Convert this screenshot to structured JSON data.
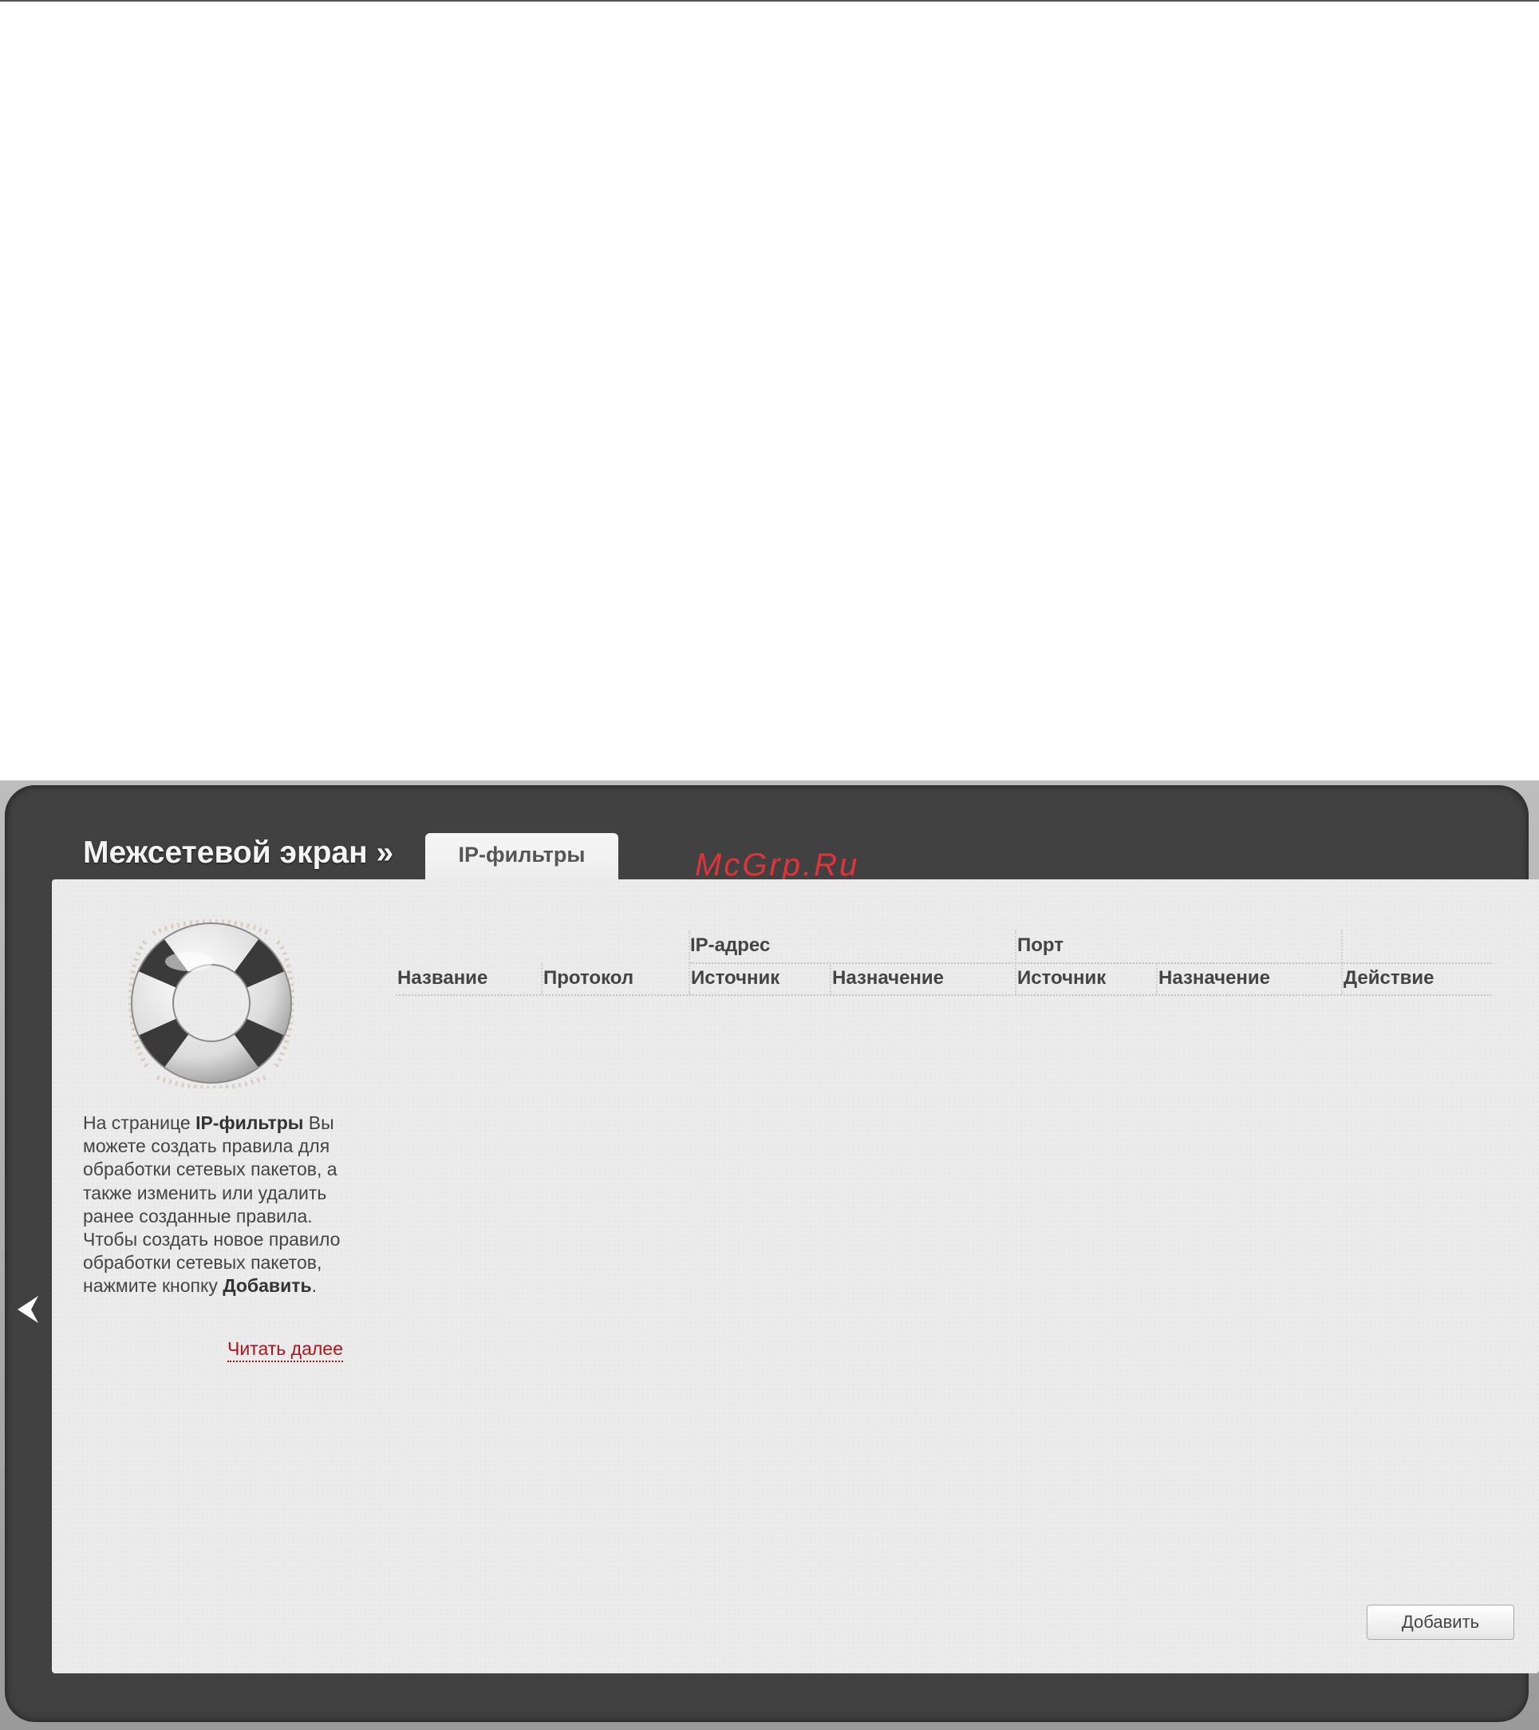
{
  "header": {
    "title": "Межсетевой экран »",
    "active_tab": "IP-фильтры",
    "watermark": "McGrp.Ru"
  },
  "help": {
    "p1": "На странице ",
    "b1": "IP-фильтры",
    "p2": " Вы можете создать правила для обработки сетевых пакетов, а также изменить или удалить ранее созданные правила. Чтобы создать новое правило обработки сетевых пакетов, нажмите кнопку ",
    "b2": "Добавить",
    "p3": ".",
    "read_more": "Читать далее"
  },
  "table": {
    "group_ip": "IP-адрес",
    "group_port": "Порт",
    "columns": [
      "Название",
      "Протокол",
      "Источник",
      "Назначение",
      "Источник",
      "Назначение",
      "Действие"
    ],
    "rows": []
  },
  "actions": {
    "add_label": "Добавить"
  },
  "icons": {
    "back": "chevron-left-icon",
    "help": "lifebuoy-icon"
  }
}
